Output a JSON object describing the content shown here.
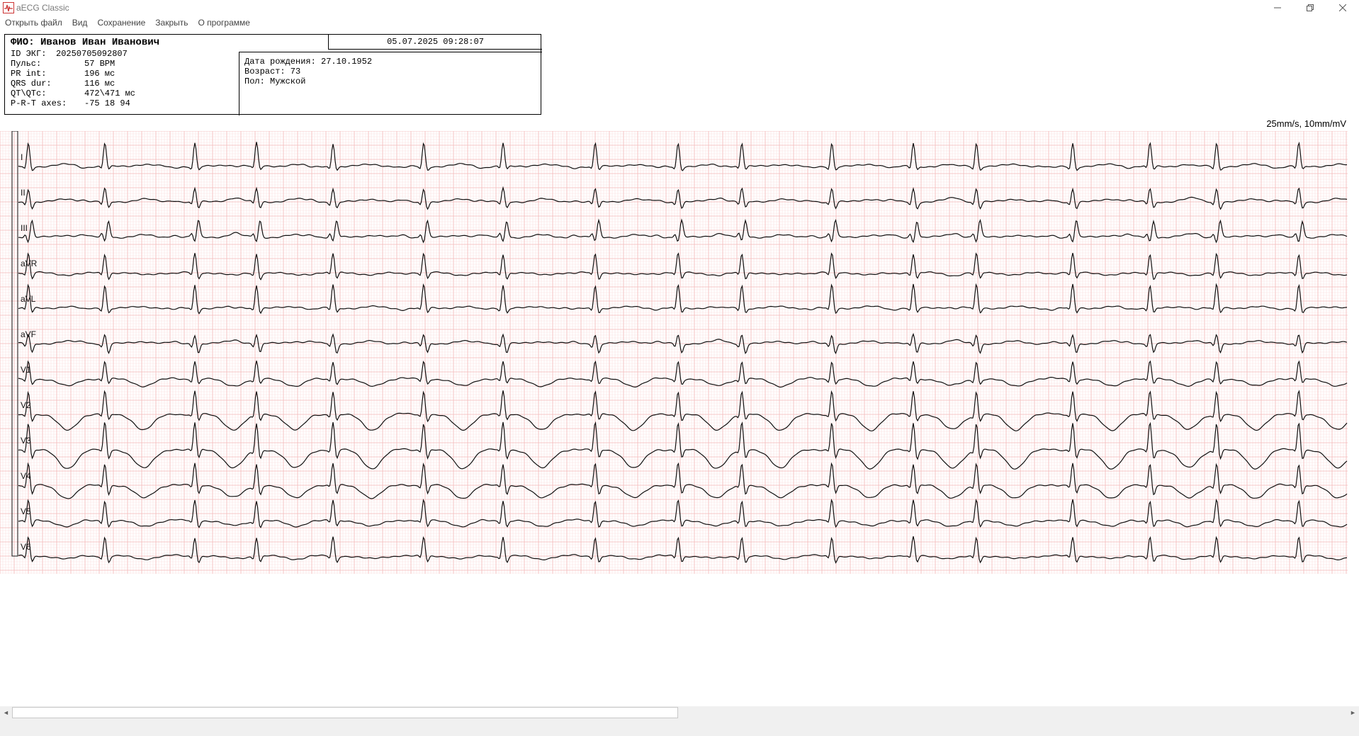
{
  "window": {
    "title": "aECG Classic",
    "icon": "ecg-app-icon",
    "controls": [
      "minimize-icon",
      "restore-icon",
      "close-icon"
    ]
  },
  "menu": {
    "items": [
      "Открыть файл",
      "Вид",
      "Сохранение",
      "Закрыть",
      "О программе"
    ]
  },
  "patient": {
    "fio": "ФИО: Иванов Иван Иванович",
    "datetime": "05.07.2025 09:28:07",
    "fields": [
      {
        "label": "ID ЭКГ:",
        "value": "20250705092807"
      },
      {
        "label": "Пульс:",
        "value": "57 BPM"
      },
      {
        "label": "PR int:",
        "value": "196 мс"
      },
      {
        "label": "QRS dur:",
        "value": "116 мс"
      },
      {
        "label": "QT\\QTc:",
        "value": "472\\471 мс"
      },
      {
        "label": "P-R-T axes:",
        "value": "-75 18 94"
      }
    ],
    "extra": [
      "Дата рождения: 27.10.1952",
      "Возраст: 73",
      "Пол: Мужской"
    ]
  },
  "ecg": {
    "speed_label": "25mm/s, 10mm/mV",
    "leads": [
      "I",
      "II",
      "III",
      "aVR",
      "aVL",
      "aVF",
      "V1",
      "V2",
      "V3",
      "V4",
      "V5",
      "V6"
    ],
    "grid_color": "#f4b8b8",
    "grid_minor_color": "#fbe1e1",
    "trace_color": "#111111"
  },
  "scrollbar": {
    "left_arrow": "◄",
    "right_arrow": "►"
  }
}
